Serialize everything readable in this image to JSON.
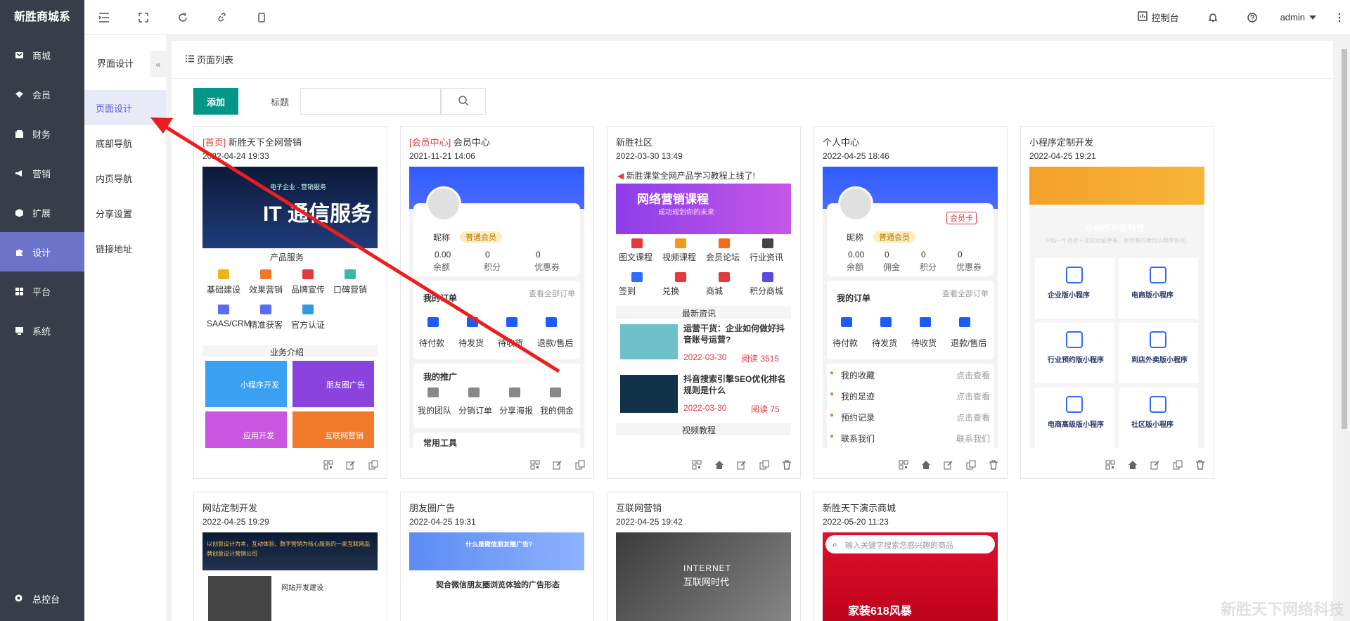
{
  "brand": "新胜商城系",
  "nav": {
    "items": [
      {
        "label": "商城",
        "icon": "store-icon"
      },
      {
        "label": "会员",
        "icon": "member-icon"
      },
      {
        "label": "财务",
        "icon": "finance-icon"
      },
      {
        "label": "营销",
        "icon": "megaphone-icon"
      },
      {
        "label": "扩展",
        "icon": "cube-icon"
      },
      {
        "label": "设计",
        "icon": "puzzle-icon"
      },
      {
        "label": "平台",
        "icon": "grid-icon"
      },
      {
        "label": "系统",
        "icon": "monitor-icon"
      }
    ],
    "bottom": "总控台"
  },
  "subnav": {
    "header": "界面设计",
    "items": [
      "页面设计",
      "底部导航",
      "内页导航",
      "分享设置",
      "链接地址"
    ]
  },
  "topbar": {
    "console": "控制台",
    "user": "admin"
  },
  "panel": {
    "title": "页面列表",
    "add": "添加",
    "filter_label": "标题"
  },
  "cards": [
    {
      "tag": "[首页]",
      "title": "新胜天下全网营销",
      "date": "2022-04-24 19:33"
    },
    {
      "tag": "[会员中心]",
      "title": "会员中心",
      "date": "2021-11-21 14:06"
    },
    {
      "tag": "",
      "title": "新胜社区",
      "date": "2022-03-30 13:49"
    },
    {
      "tag": "",
      "title": "个人中心",
      "date": "2022-04-25 18:46"
    },
    {
      "tag": "",
      "title": "小程序定制开发",
      "date": "2022-04-25 19:21"
    },
    {
      "tag": "",
      "title": "网站定制开发",
      "date": "2022-04-25 19:29"
    },
    {
      "tag": "",
      "title": "朋友圈广告",
      "date": "2022-04-25 19:31"
    },
    {
      "tag": "",
      "title": "互联网营销",
      "date": "2022-04-25 19:42"
    },
    {
      "tag": "",
      "title": "新胜天下演示商城",
      "date": "2022-05-20 11:23"
    }
  ],
  "previews": {
    "home": {
      "banner_big": "IT 通信服务",
      "banner_small": "电子企业 · 营销服务",
      "section": "产品服务",
      "icons": [
        "基础建设",
        "效果营销",
        "品牌宣传",
        "口碑营销",
        "SAAS/CRM",
        "精准获客",
        "官方认证"
      ],
      "biz": "业务介绍",
      "tiles": [
        "小程序开发",
        "朋友圈广告",
        "应用开发",
        "互联网营销"
      ]
    },
    "member": {
      "name": "昵称",
      "level": "普通会员",
      "stats": [
        {
          "v": "0.00",
          "k": "余额"
        },
        {
          "v": "0",
          "k": "积分"
        },
        {
          "v": "0",
          "k": "优惠券"
        }
      ],
      "orders": "我的订单",
      "all_orders": "查看全部订单",
      "order_items": [
        "待付款",
        "待发货",
        "待收货",
        "退款/售后"
      ],
      "promo": "我的推广",
      "promo_items": [
        "我的团队",
        "分销订单",
        "分享海报",
        "我的佣金"
      ],
      "tools": "常用工具"
    },
    "community": {
      "notice": "新胜课堂全网产品学习教程上线了!",
      "banner": "网络营销课程",
      "banner_sub": "成功规划你的未来",
      "grid": [
        "图文课程",
        "视频课程",
        "会员论坛",
        "行业资讯",
        "签到",
        "兑换",
        "商城",
        "积分商城"
      ],
      "news_head": "最新资讯",
      "news": [
        {
          "title": "运营干货：企业如何做好抖音账号运营?",
          "date": "2022-03-30",
          "read": "阅读 3515"
        },
        {
          "title": "抖音搜索引擎SEO优化排名规则是什么",
          "date": "2022-03-30",
          "read": "阅读 75"
        }
      ],
      "video_head": "视频教程"
    },
    "personal": {
      "name": "昵称",
      "level": "普通会员",
      "card": "会员卡",
      "stats": [
        {
          "v": "0.00",
          "k": "余额"
        },
        {
          "v": "0",
          "k": "佣金"
        },
        {
          "v": "0",
          "k": "积分"
        },
        {
          "v": "0",
          "k": "优惠券"
        }
      ],
      "orders": "我的订单",
      "all_orders": "查看全部订单",
      "order_items": [
        "待付款",
        "待发货",
        "待收货",
        "退款/售后"
      ],
      "list": [
        {
          "k": "我的收藏",
          "v": "点击查看"
        },
        {
          "k": "我的足迹",
          "v": "点击查看"
        },
        {
          "k": "预约记录",
          "v": "点击查看"
        },
        {
          "k": "联系我们",
          "v": "联系我们"
        }
      ]
    },
    "miniapp": {
      "heading": "小程序功能特性",
      "sub": "平均一个月近十次的功能更新，更完善的微信小程序系统。",
      "tiles": [
        "企业版小程序",
        "电商版小程序",
        "行业预约版小程序",
        "到店外卖版小程序",
        "电商高级版小程序",
        "社区版小程序"
      ]
    },
    "website": {
      "banner": "以创意设计为本，互动体验、数字营销为核心服务的一家互联网品牌创意设计营销公司",
      "section": "网站开发建设"
    },
    "moments": {
      "banner": "什么是微信朋友圈广告?",
      "section": "契合微信朋友圈浏览体验的广告形态"
    },
    "internet": {
      "banner1": "INTERNET",
      "banner2": "互联网时代"
    },
    "shop": {
      "search": "输入关键字搜索您感兴趣的商品",
      "promo": "家装618风暴"
    }
  },
  "watermark": "新胜天下网络科技",
  "colors": {
    "sidebar": "#393d49",
    "active": "#6b74c9",
    "add": "#009688",
    "tag": "#e4393c"
  }
}
